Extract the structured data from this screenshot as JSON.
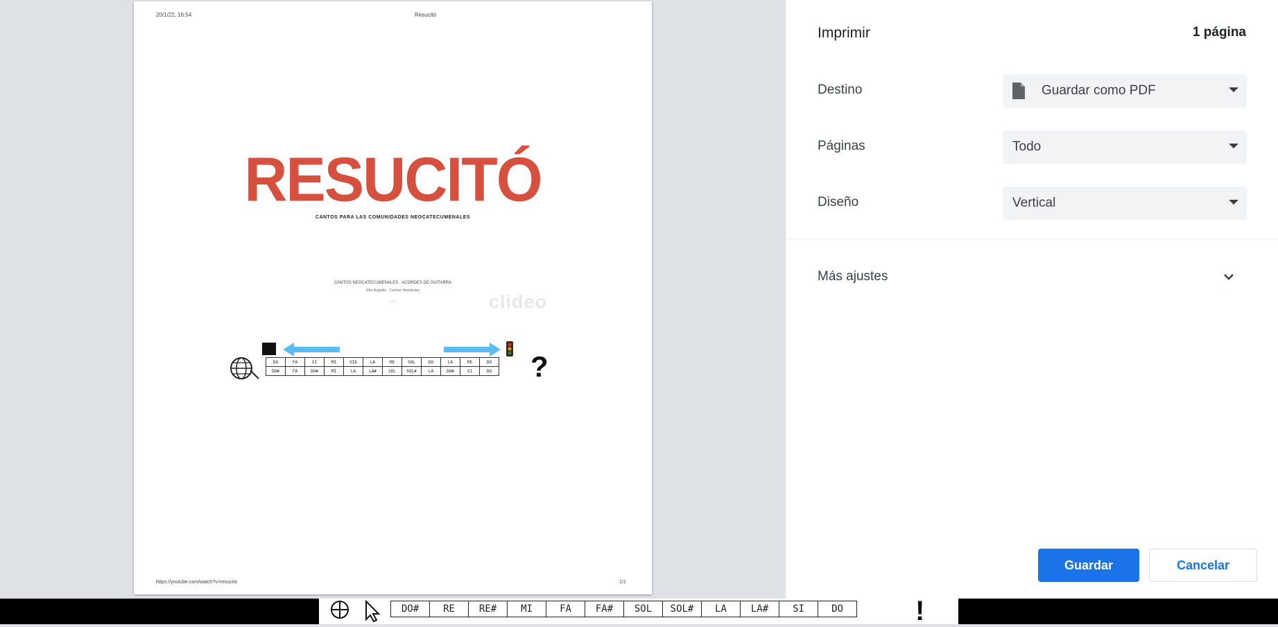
{
  "preview": {
    "header_date": "20/1/22, 16:54",
    "header_title": "Resucitó",
    "title": "RESUCITÓ",
    "subtitle": "CANTOS PARA LAS COMUNIDADES NEOCATECUMENALES",
    "credit_line1": "CANTOS NEOCATECUMENALES · ACORDES DE GUITARRA",
    "credit_line2": "Kiko Argüello · Carmen Hernández",
    "credit_line3": "·····",
    "watermark": "clideo",
    "footer_url": "https://youtube.com/watch?v=resucito",
    "footer_page": "1/1",
    "notes_row1": [
      "DO",
      "FA",
      "SI",
      "MI",
      "SIb",
      "LA",
      "RE",
      "SOL",
      "DO",
      "LA",
      "RE",
      "DO"
    ],
    "notes_row2": [
      "DO#",
      "FA",
      "DO#",
      "MI",
      "LA",
      "LA#",
      "SOL",
      "SOL#",
      "LA",
      "DO#",
      "SI",
      "DO"
    ]
  },
  "settings": {
    "title": "Imprimir",
    "page_count": "1 página",
    "destination_label": "Destino",
    "destination_value": "Guardar como PDF",
    "pages_label": "Páginas",
    "pages_value": "Todo",
    "layout_label": "Diseño",
    "layout_value": "Vertical",
    "more_settings_label": "Más ajustes",
    "save_button": "Guardar",
    "cancel_button": "Cancelar"
  },
  "bottom_bar": {
    "notes": [
      "DO#",
      "RE",
      "RE#",
      "MI",
      "FA",
      "FA#",
      "SOL",
      "SOL#",
      "LA",
      "LA#",
      "SI",
      "DO"
    ],
    "exclamation": "!"
  },
  "colors": {
    "title_red": "#d5503f",
    "accent_blue": "#1a73e8",
    "arrow_blue": "#5bbcf0",
    "panel_gray": "#dee1e6"
  },
  "icons": [
    "document-icon",
    "chevron-down-icon",
    "globe-icon",
    "arrow-left-icon",
    "arrow-right-icon",
    "traffic-light-icon",
    "cursor-icon"
  ]
}
